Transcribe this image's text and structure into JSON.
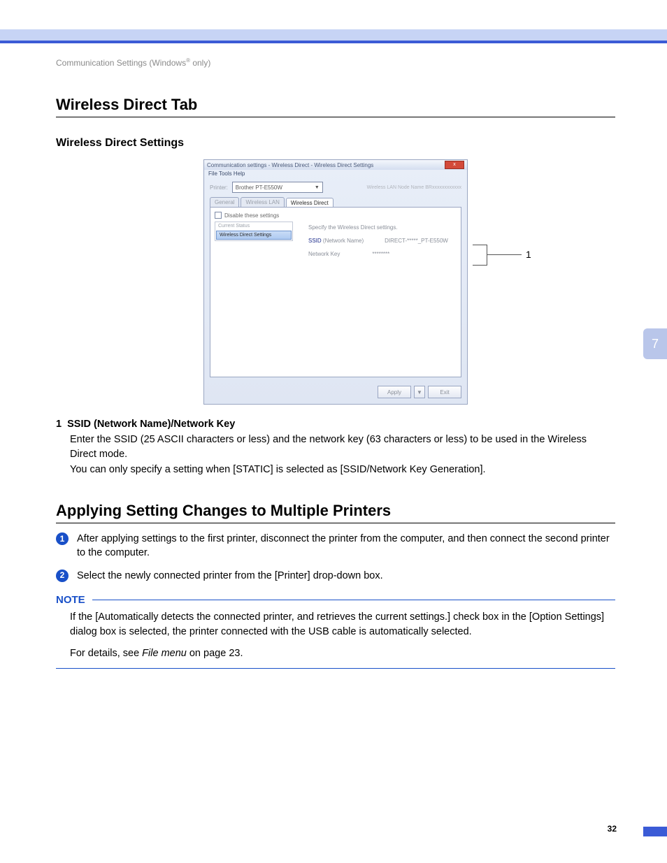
{
  "chapter_tab": "7",
  "page_number": "32",
  "breadcrumb_pre": "Communication Settings (Windows",
  "breadcrumb_sup": "®",
  "breadcrumb_post": " only)",
  "h1a": "Wireless Direct Tab",
  "h2a": "Wireless Direct Settings",
  "win": {
    "title": "Communication settings - Wireless Direct - Wireless Direct Settings",
    "close": "x",
    "menu": "File   Tools   Help",
    "printer_lbl": "Printer:",
    "printer_val": "Brother PT-E550W",
    "node_info": "Wireless LAN Node Name   BRxxxxxxxxxxxx",
    "tab1": "General",
    "tab2": "Wireless LAN",
    "tab3": "Wireless Direct",
    "chk": "Disable these settings",
    "sb_hdr": "Current Status",
    "sb_sel": "Wireless Direct Settings",
    "rp_caption": "Specify the Wireless Direct settings.",
    "rp_ssid_lbl": "SSID",
    "rp_ssid_sub": "(Network Name)",
    "rp_ssid_val": "DIRECT-*****_PT-E550W",
    "rp_key_lbl": "Network Key",
    "rp_key_val": "********",
    "btn_apply": "Apply",
    "btn_exit": "Exit"
  },
  "callout1": "1",
  "def_num": "1",
  "def_title": "SSID (Network Name)/Network Key",
  "def_p1": "Enter the SSID (25 ASCII characters or less) and the network key (63 characters or less) to be used in the Wireless Direct mode.",
  "def_p2": "You can only specify a setting when [STATIC] is selected as [SSID/Network Key Generation].",
  "h1b": "Applying Setting Changes to Multiple Printers",
  "step1": "After applying settings to the first printer, disconnect the printer from the computer, and then connect the second printer to the computer.",
  "step2": "Select the newly connected printer from the [Printer] drop-down box.",
  "note_label": "NOTE",
  "note_p1": "If the [Automatically detects the connected printer, and retrieves the current settings.] check box in the [Option Settings] dialog box is selected, the printer connected with the USB cable is automatically selected.",
  "note_p2_pre": "For details, see ",
  "note_p2_link": "File menu",
  "note_p2_post": " on page 23."
}
